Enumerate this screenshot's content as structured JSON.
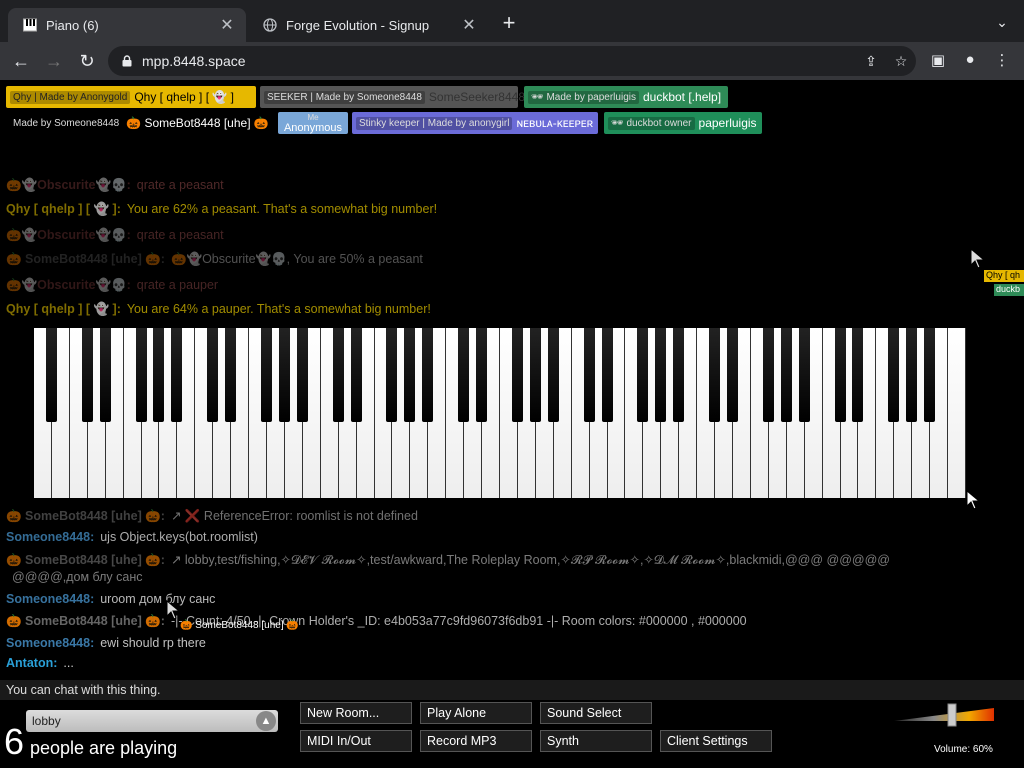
{
  "browser": {
    "tabs": [
      {
        "title": "Piano (6)",
        "active": true,
        "icon": "piano-icon"
      },
      {
        "title": "Forge Evolution - Signup",
        "active": false,
        "icon": "globe-icon"
      }
    ],
    "url": "mpp.8448.space"
  },
  "nametags": [
    {
      "tag": "Qhy | Made by Anonygold",
      "name": "Qhy [ qhelp ] [ 👻 ]",
      "bg": "#e6b800",
      "color": "#000"
    },
    {
      "tag": "SEEKER | Made by Someone8448",
      "name": "SomeSeeker8448",
      "bg": "#555",
      "color": "#333"
    },
    {
      "tag": "🕶 Made by paperluigis",
      "name": "duckbot [.help]",
      "bg": "#2e8b57",
      "color": "#fff"
    },
    {
      "tag": "Made by Someone8448",
      "name": "🎃 SomeBot8448 [uhe] 🎃",
      "bg": "#000",
      "color": "#fff"
    },
    {
      "tag": "Me",
      "name": "Anonymous",
      "bg": "#7aa7d8",
      "color": "#fff"
    },
    {
      "tag": "Stinky keeper | Made by anonygirl",
      "name": "ɴᴇʙᴜʟᴀ-ᴋᴇᴇᴘᴇʀ",
      "bg": "#6b6bd8",
      "color": "#fff"
    },
    {
      "tag": "🕶 duckbot owner",
      "name": "paperluigis",
      "bg": "#1f8f5a",
      "color": "#fff"
    }
  ],
  "chat": [
    {
      "who": "🎃👻Obscurite👻💀:",
      "msg": "qrate a peasant",
      "color": "#7a3b3b",
      "fade": 0.45
    },
    {
      "who": "Qhy [ qhelp ] [ 👻 ]:",
      "msg": "You are 62% a peasant. That's a somewhat big number!",
      "color": "#b59b00",
      "fade": 0.7
    },
    {
      "who": "🎃👻Obscurite👻💀:",
      "msg": "qrate a peasant",
      "color": "#7a3b3b",
      "fade": 0.4
    },
    {
      "who": "🎃 SomeBot8448 [uhe] 🎃:",
      "msg": "🎃👻Obscurite👻💀, You are 50% a peasant",
      "color": "#555",
      "fade": 0.4
    },
    {
      "who": "🎃👻Obscurite👻💀:",
      "msg": "qrate a pauper",
      "color": "#7a3b3b",
      "fade": 0.4
    },
    {
      "who": "Qhy [ qhelp ] [ 👻 ]:",
      "msg": "You are 64% a pauper. That's a somewhat big number!",
      "color": "#b59b00",
      "fade": 0.7
    },
    {
      "who": "🎃 SomeBot8448 [uhe] 🎃:",
      "msg": "↗ ❌ ReferenceError: roomlist is not defined",
      "color": "#777",
      "fade": 0.55
    },
    {
      "who": "Someone8448:",
      "msg": "ujs Object.keys(bot.roomlist)",
      "color": "#3e7fb0",
      "fade": 0.85
    },
    {
      "who": "🎃 SomeBot8448 [uhe] 🎃:",
      "msg": "↗ lobby,test/fishing,✧𝓓𝓔𝓥 𝓡𝓸𝓸𝓶✧,test/awkward,The Roleplay Room,✧𝓡𝓟 𝓡𝓸𝓸𝓶✧,✧𝓓𝓜 𝓡𝓸𝓸𝓶✧,blackmidi,@@@ @@@@@",
      "color": "#777",
      "fade": 0.6
    },
    {
      "who": "",
      "msg": "@@@@,дом блу санс",
      "color": "#777",
      "fade": 0.6
    },
    {
      "who": "Someone8448:",
      "msg": "uroom дом блу санс",
      "color": "#3e7fb0",
      "fade": 0.9
    },
    {
      "who": "🎃 SomeBot8448 [uhe] 🎃:",
      "msg": "-|- Count: 4/50 -|- Crown Holder's _ID: e4b053a77c9fd96073f6db91 -|- Room colors: #000000 , #000000",
      "color": "#777",
      "fade": 0.85
    },
    {
      "who": "Someone8448:",
      "msg": "ewi should rp there",
      "color": "#3e7fb0",
      "fade": 0.95
    },
    {
      "who": "Antaton:",
      "msg": "...",
      "color": "#2aa0d8",
      "fade": 1
    }
  ],
  "cursor_label": "🎃 SomeBot8448 [uhe] 🎃",
  "far_label": {
    "a": "Qhy [ qh",
    "b": "duckb"
  },
  "chat_input_placeholder": "You can chat with this thing.",
  "room": {
    "name": "lobby",
    "count": "6",
    "text": "people are playing"
  },
  "buttons": [
    {
      "label": "New Room...",
      "col": 0,
      "row": 0
    },
    {
      "label": "Play Alone",
      "col": 1,
      "row": 0
    },
    {
      "label": "Sound Select",
      "col": 2,
      "row": 0
    },
    {
      "label": "MIDI In/Out",
      "col": 0,
      "row": 1
    },
    {
      "label": "Record MP3",
      "col": 1,
      "row": 1
    },
    {
      "label": "Synth",
      "col": 2,
      "row": 1
    },
    {
      "label": "Client Settings",
      "col": 3,
      "row": 1
    }
  ],
  "volume": {
    "label": "Volume: 60%",
    "level": 0.6
  },
  "colors": {
    "page_bg": "#000000",
    "chrome_bg": "#202124",
    "toolbar_bg": "#35363a"
  }
}
